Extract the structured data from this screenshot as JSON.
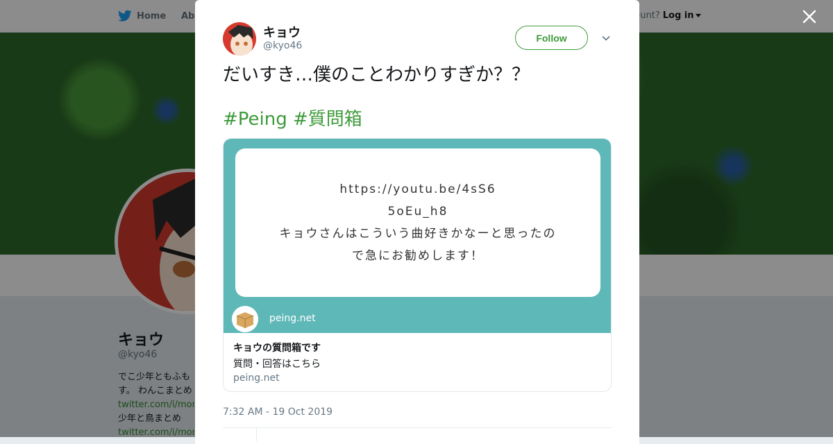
{
  "background_page": {
    "nav": {
      "home_label": "Home",
      "about_label": "Abo",
      "account_prompt": "ccount?",
      "login_label": "Log in"
    },
    "profile": {
      "name": "キョウ",
      "handle": "@kyo46",
      "bio_line1": "でこ少年ともふも",
      "bio_line2": "す。 わんこまとめ",
      "bio_link1": "twitter.com/i/mom",
      "bio_line3": "少年と鳥まとめ",
      "bio_link2": "twitter.com/i/mom"
    }
  },
  "tweet": {
    "author_name": "キョウ",
    "author_handle": "@kyo46",
    "follow_label": "Follow",
    "text": "だいすき…僕のことわかりすぎか？？",
    "hashtags": [
      "#Peing",
      "#質問箱"
    ],
    "card": {
      "image_lines": [
        "https://youtu.be/4sS6",
        "5oEu_h8",
        "キョウさんはこういう曲好きかなーと思ったの",
        "で急にお勧めします！"
      ],
      "image_site": "peing.net",
      "title": "キョウの質問箱です",
      "description": "質問・回答はこちら",
      "domain": "peing.net"
    },
    "timestamp": "7:32 AM - 19 Oct 2019"
  },
  "colors": {
    "accent_green": "#3d9a3a",
    "card_teal": "#5fb8b8",
    "twitter_blue": "#1da1f2"
  }
}
